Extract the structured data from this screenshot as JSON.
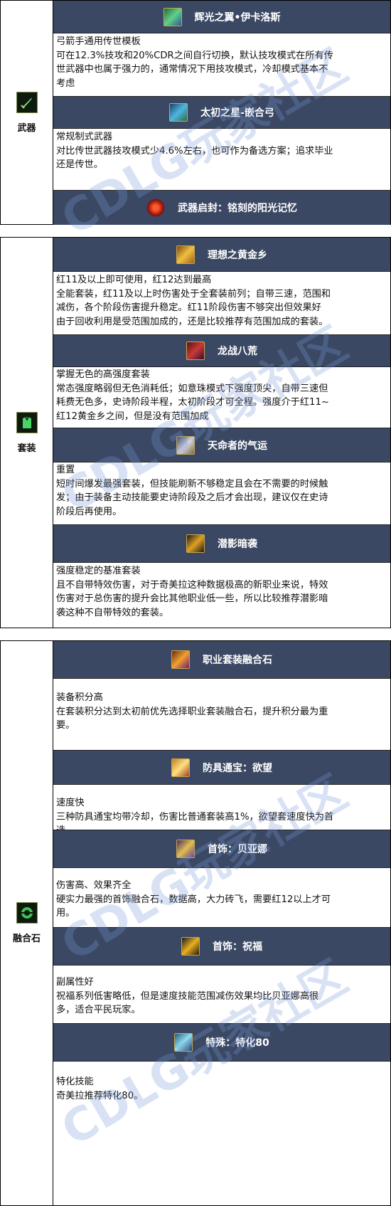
{
  "watermark_text": "CDLG玩家社区",
  "sections": {
    "weapon": {
      "category": "武器",
      "items": [
        {
          "title": "辉光之翼•伊卡洛斯",
          "lines": [
            "弓箭手通用传世模板",
            "可在12.3%技攻和20%CDR之间自行切换，默认技攻模式在所有传",
            "世武器中也属于强力的，通常情况下用技攻模式，冷却模式基本不",
            "考虑"
          ]
        },
        {
          "title": "太初之星-嵌合弓",
          "lines": [
            "常规制式武器",
            "对比传世武器技攻模式少4.6%左右，也可作为备选方案；追求毕业",
            "还是传世。"
          ]
        },
        {
          "title": "武器启封：铭刻的阳光记忆",
          "lines": []
        }
      ]
    },
    "set": {
      "category": "套装",
      "items": [
        {
          "title": "理想之黄金乡",
          "lines": [
            "红11及以上即可使用，红12达到最高",
            "全能套装，红11及以上时伤害处于全套装前列；自带三速，范围和",
            "减伤，各个阶段伤害提升稳定。红11阶段伤害不够突出但效果好",
            "由于回收利用是受范围加成的，还是比较推荐有范围加成的套装。"
          ]
        },
        {
          "title": "龙战八荒",
          "lines": [
            "掌握无色的高强度套装",
            "常态强度略弱但无色消耗低；如意珠模式下强度顶尖，自带三速但",
            "耗费无色多，史诗阶段半程，太初阶段才可全程。强度介于红11~",
            "红12黄金乡之间，但是没有范围加成"
          ]
        },
        {
          "title": "天命者的气运",
          "lines": [
            "重置",
            "短时间爆发最强套装，但技能刷新不够稳定且会在不需要的时候触",
            "发；由于装备主动技能要史诗阶段及之后才会出现，建议仅在史诗",
            "阶段后再使用。"
          ]
        },
        {
          "title": "潜影暗袭",
          "lines": [
            "强度稳定的基准套装",
            "且不自带特效伤害，对于奇美拉这种数据极高的新职业来说，特效",
            "伤害对于总伤害的提升会比其他职业低一些，所以比较推荐潜影暗",
            "袭这种不自带特效的套装。"
          ]
        }
      ]
    },
    "fusion": {
      "category": "融合石",
      "items": [
        {
          "title": "职业套装融合石",
          "lines": [
            "装备积分高",
            "在套装积分达到太初前优先选择职业套装融合石，提升积分最为重",
            "要。"
          ]
        },
        {
          "title": "防具通宝：欲望",
          "lines": [
            "速度快",
            "三种防具通宝均带冷却，伤害比普通套装高1%，欲望套速度快为首",
            "选。"
          ]
        },
        {
          "title": "首饰：贝亚娜",
          "lines": [
            "伤害高、效果齐全",
            "硬实力最强的首饰融合石，数据高，大力砖飞，需要红12以上才可",
            "用。"
          ]
        },
        {
          "title": "首饰：祝福",
          "lines": [
            "副属性好",
            "祝福系列低害略低，但是速度技能范围减伤效果均比贝亚娜高很",
            "多，适合平民玩家。"
          ]
        },
        {
          "title": "特殊：特化80",
          "lines": [
            "特化技能",
            "奇美拉推荐特化80。"
          ]
        }
      ]
    }
  },
  "colors": {
    "header_bg": "#3b4863",
    "header_text": "#ffffff",
    "category_icon_bg": "#0d1a0d",
    "watermark": "#7896d7"
  }
}
